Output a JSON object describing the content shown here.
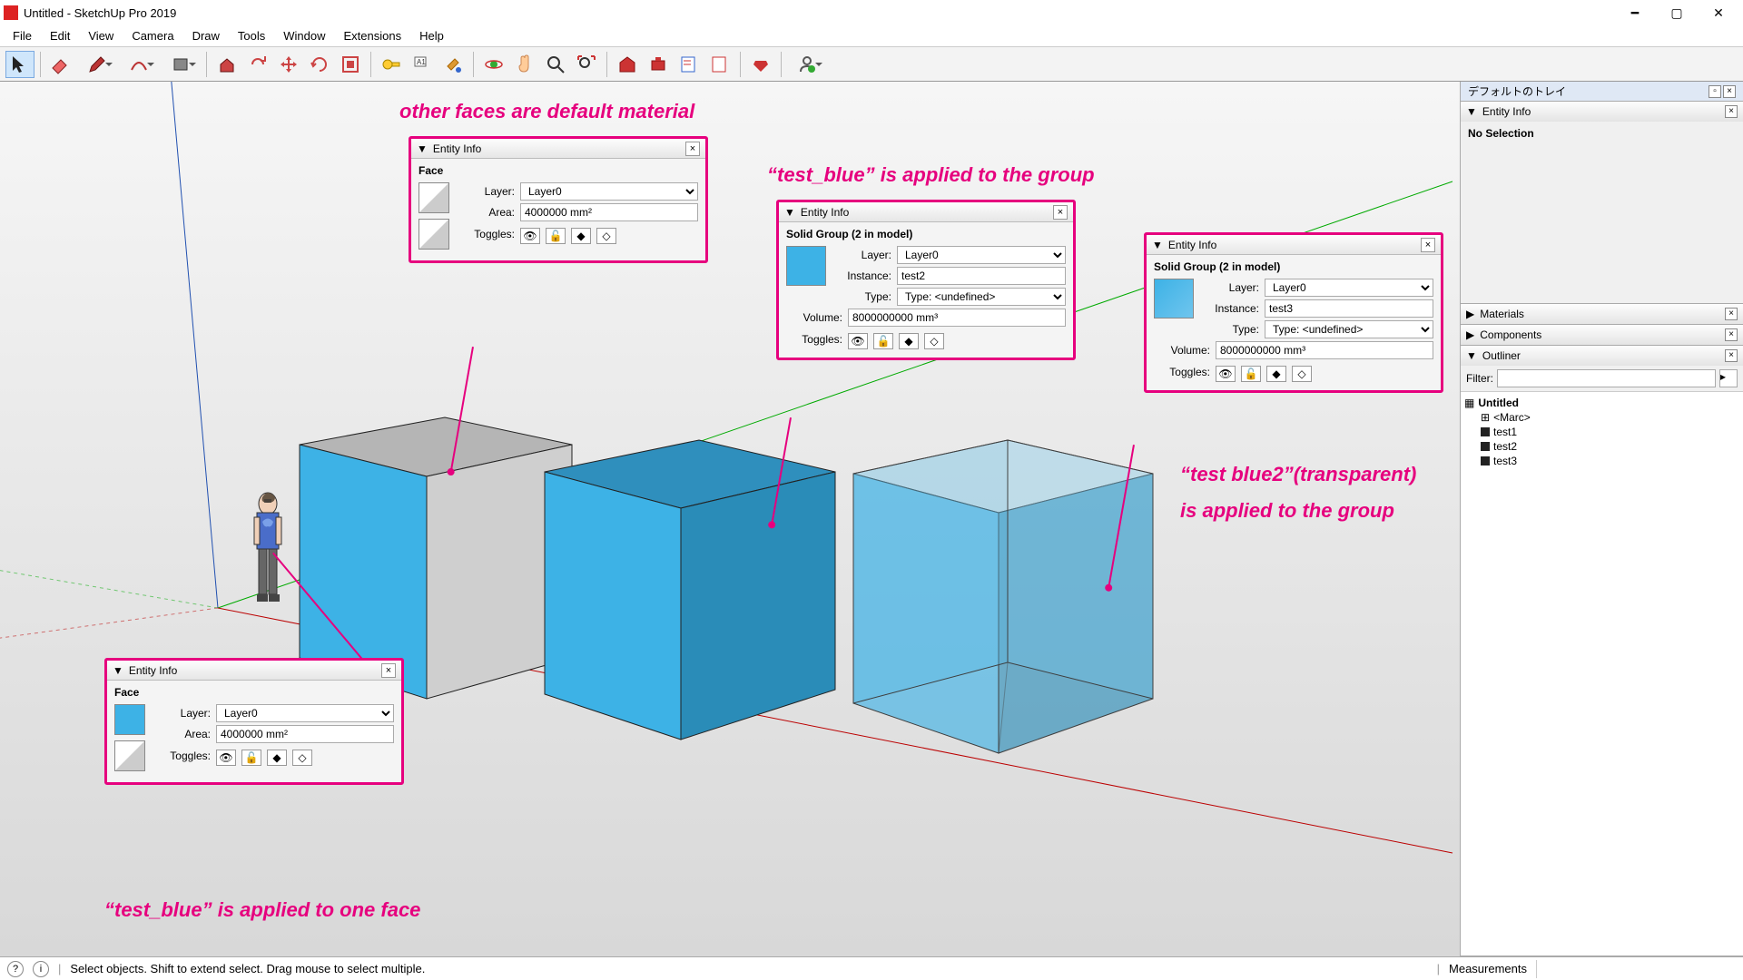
{
  "window": {
    "title": "Untitled - SketchUp Pro 2019"
  },
  "menu": [
    "File",
    "Edit",
    "View",
    "Camera",
    "Draw",
    "Tools",
    "Window",
    "Extensions",
    "Help"
  ],
  "tray": {
    "title": "デフォルトのトレイ",
    "entity_info": {
      "header": "Entity Info",
      "no_selection": "No Selection"
    },
    "materials": "Materials",
    "components": "Components",
    "outliner": {
      "header": "Outliner",
      "filter_label": "Filter:",
      "root": "Untitled",
      "marc": "<Marc>",
      "items": [
        "test1",
        "test2",
        "test3"
      ]
    }
  },
  "panels": {
    "p1": {
      "title": "Entity Info",
      "type": "Face",
      "labels": {
        "layer": "Layer:",
        "area": "Area:",
        "toggles": "Toggles:"
      },
      "layer": "Layer0",
      "area": "4000000 mm²"
    },
    "p2": {
      "title": "Entity Info",
      "type": "Face",
      "labels": {
        "layer": "Layer:",
        "area": "Area:",
        "toggles": "Toggles:"
      },
      "layer": "Layer0",
      "area": "4000000 mm²"
    },
    "p3": {
      "title": "Entity Info",
      "type": "Solid Group (2 in model)",
      "labels": {
        "layer": "Layer:",
        "instance": "Instance:",
        "type": "Type:",
        "volume": "Volume:",
        "toggles": "Toggles:"
      },
      "layer": "Layer0",
      "instance": "test2",
      "type_val": "Type: <undefined>",
      "volume": "8000000000 mm³"
    },
    "p4": {
      "title": "Entity Info",
      "type": "Solid Group (2 in model)",
      "labels": {
        "layer": "Layer:",
        "instance": "Instance:",
        "type": "Type:",
        "volume": "Volume:",
        "toggles": "Toggles:"
      },
      "layer": "Layer0",
      "instance": "test3",
      "type_val": "Type: <undefined>",
      "volume": "8000000000 mm³"
    }
  },
  "annotations": {
    "a1": "other faces are default material",
    "a2": "“test_blue” is applied to the group",
    "a3": "“test blue2”(transparent)",
    "a3b": "is applied to the group",
    "a4": "“test_blue” is applied to one face"
  },
  "status": {
    "hint": "Select objects. Shift to extend select. Drag mouse to select multiple.",
    "measurements": "Measurements"
  }
}
